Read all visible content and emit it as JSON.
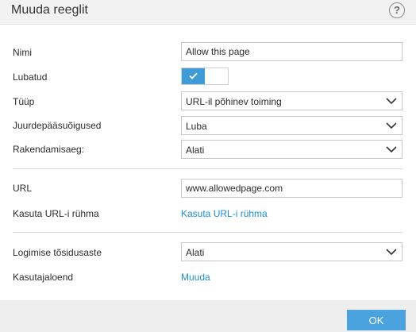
{
  "window": {
    "title": "Muuda reeglit",
    "help_label": "?"
  },
  "form": {
    "name": {
      "label": "Nimi",
      "value": "Allow this page"
    },
    "enabled": {
      "label": "Lubatud",
      "state": true
    },
    "type": {
      "label": "Tüüp",
      "value": "URL-il põhinev toiming"
    },
    "access": {
      "label": "Juurdepääsuõigused",
      "value": "Luba"
    },
    "schedule": {
      "label": "Rakendamisaeg:",
      "value": "Alati"
    },
    "url": {
      "label": "URL",
      "value": "www.allowedpage.com"
    },
    "url_group": {
      "label": "Kasuta URL-i rühma",
      "link": "Kasuta URL-i rühma"
    },
    "log_severity": {
      "label": "Logimise tõsidusaste",
      "value": "Alati"
    },
    "user_list": {
      "label": "Kasutajaloend",
      "link": "Muuda"
    }
  },
  "footer": {
    "ok_label": "OK"
  },
  "colors": {
    "accent": "#3e9bd5",
    "link": "#1a8ed6",
    "button": "#4aa3df"
  }
}
